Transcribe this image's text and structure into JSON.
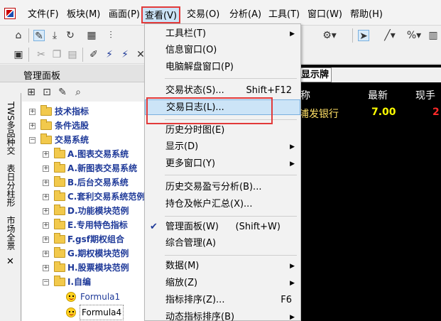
{
  "menubar": {
    "items": [
      "文件(F)",
      "板块(M)",
      "画面(P)",
      "查看(V)",
      "交易(O)",
      "分析(A)",
      "工具(T)",
      "窗口(W)",
      "帮助(H)"
    ],
    "active": "查看(V)"
  },
  "panel": {
    "title": "管理面板"
  },
  "vtabs": [
    "TWS多品种交",
    "表日分柱形",
    "市场全景"
  ],
  "vclose": "✕",
  "tree": {
    "nodes": [
      {
        "label": "技术指标",
        "expander": "+"
      },
      {
        "label": "条件选股",
        "expander": "+"
      },
      {
        "label": "交易系统",
        "expander": "−"
      },
      {
        "label": "A.图表交易系统",
        "expander": "+"
      },
      {
        "label": "A.新图表交易系统",
        "expander": "+"
      },
      {
        "label": "B.后台交易系统",
        "expander": "+"
      },
      {
        "label": "C.套利交易系统范例",
        "expander": "+"
      },
      {
        "label": "D.功能模块范例",
        "expander": "+"
      },
      {
        "label": "E.专用特色指标",
        "expander": "+"
      },
      {
        "label": "F.gsf期权组合",
        "expander": "+"
      },
      {
        "label": "G.期权模块范例",
        "expander": "+"
      },
      {
        "label": "H.股票模块范例",
        "expander": "+"
      },
      {
        "label": "I.自编",
        "expander": "−"
      }
    ],
    "formulas": [
      "Formula1",
      "Formula4"
    ]
  },
  "quote": {
    "tab": "显示牌",
    "headers": [
      "称",
      "最新",
      "现手"
    ],
    "row": {
      "name": "浦发银行",
      "price": "7.00",
      "vol": "2"
    }
  },
  "dropdown": {
    "items": [
      {
        "label": "工具栏(T)",
        "shortcut": "",
        "submenu": true
      },
      {
        "label": "信息窗口(O)",
        "shortcut": "",
        "submenu": false
      },
      {
        "label": "电脑解盘窗口(P)",
        "shortcut": "",
        "submenu": false
      },
      {
        "label": "交易状态(S)...",
        "shortcut": "Shift+F12",
        "submenu": false
      },
      {
        "label": "交易日志(L)...",
        "shortcut": "",
        "submenu": false,
        "highlighted": true
      },
      {
        "label": "历史分时图(E)",
        "shortcut": "",
        "submenu": false
      },
      {
        "label": "显示(D)",
        "shortcut": "",
        "submenu": true
      },
      {
        "label": "更多窗口(Y)",
        "shortcut": "",
        "submenu": true
      },
      {
        "label": "历史交易盈亏分析(B)...",
        "shortcut": "",
        "submenu": false
      },
      {
        "label": "持仓及帐户汇总(X)...",
        "shortcut": "",
        "submenu": false
      },
      {
        "label": "管理面板(W)",
        "shortcut": "(Shift+W)",
        "submenu": false,
        "checked": true
      },
      {
        "label": "综合管理(A)",
        "shortcut": "",
        "submenu": false
      },
      {
        "label": "数据(M)",
        "shortcut": "",
        "submenu": true
      },
      {
        "label": "缩放(Z)",
        "shortcut": "",
        "submenu": true
      },
      {
        "label": "指标排序(Z)...",
        "shortcut": "F6",
        "submenu": false
      },
      {
        "label": "动态指标排序(B)",
        "shortcut": "",
        "submenu": true
      }
    ]
  },
  "colors": {
    "accent_red": "#e23a3a",
    "highlight": "#cce4f7",
    "tree_text": "#1f3a99"
  }
}
